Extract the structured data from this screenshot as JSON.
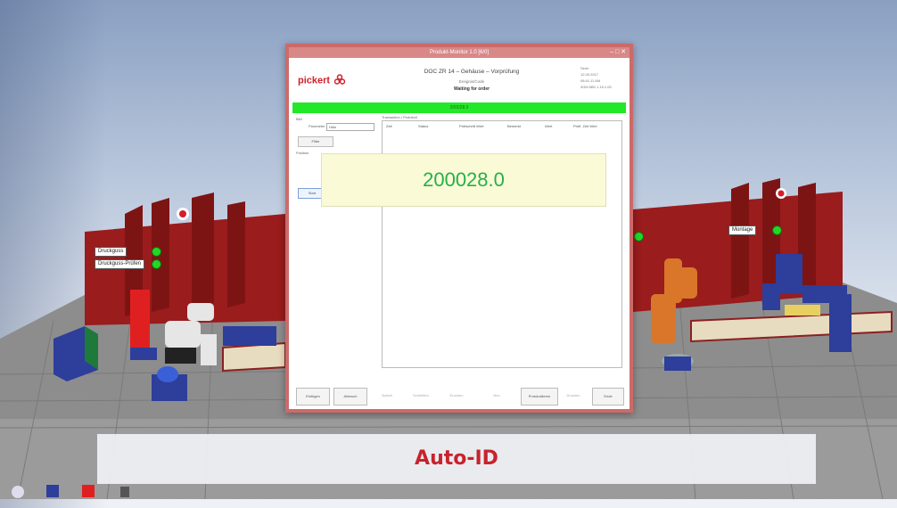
{
  "scene": {
    "left_station_labels": [
      "Druckguss",
      "Druckguss-Prüfen"
    ],
    "right_station_label": "Montage",
    "caption": "Auto-ID",
    "accent": "#c8232c",
    "wall_color": "#9a1c1c",
    "status_green": "#22e827"
  },
  "window": {
    "title": "Produkt-Monitor 1.0 [6/0]",
    "controls": "–  □  ✕",
    "logo": "pickert",
    "product_title": "DOC ZR 14 – Gehäuse – Vorprüfung",
    "product_sub": "Ereignis/Code",
    "status": "Waiting for order",
    "info_lines": [
      "Serie",
      "12.09.2017",
      "08:41:11 AM",
      "3GM 6B0 1.15.1.00"
    ],
    "green_bar_value": "200028.0",
    "left_group_label": "Bild",
    "param_label": "Parameter",
    "param_value": "Hüls",
    "left_button_1": "Filter",
    "left_group_label_2": "Position",
    "left_button_2": "Start",
    "table_label": "Transaction / Protokoll",
    "table_headers": [
      "Zeit",
      "Status",
      "Prüfschritt Wert",
      "Bemerkt",
      "Wert",
      "Prüfl. Zeit Wert"
    ],
    "overlay_value": "200028.0",
    "bottom_buttons": [
      {
        "label": "Einfügen",
        "enabled": true
      },
      {
        "label": "Abbruch",
        "enabled": true
      },
      {
        "label": "Speich",
        "enabled": false
      },
      {
        "label": "Schließen",
        "enabled": false
      },
      {
        "label": "Drucken",
        "enabled": false
      },
      {
        "label": "Neu",
        "enabled": false
      },
      {
        "label": "Protokollieren",
        "enabled": true
      },
      {
        "label": "Drucken",
        "enabled": false
      },
      {
        "label": "Ende",
        "enabled": true
      }
    ]
  }
}
